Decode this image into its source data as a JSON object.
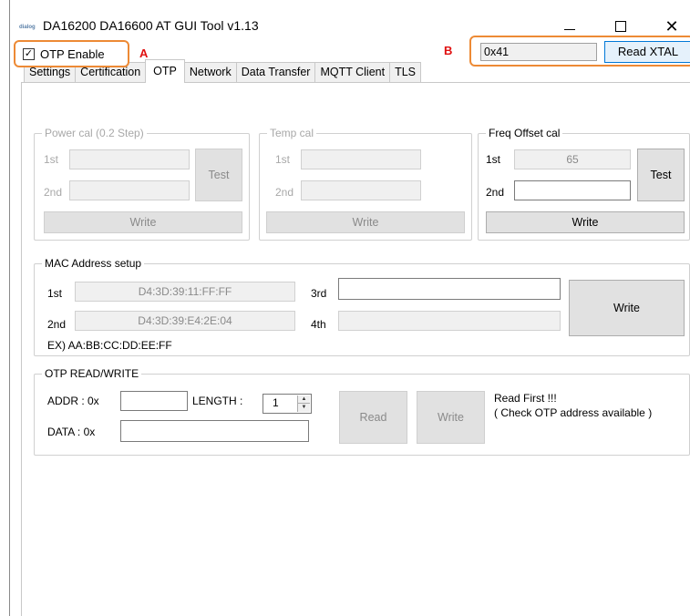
{
  "window": {
    "title": "DA16200 DA16600 AT GUI Tool v1.13",
    "app_icon_text": "dialog"
  },
  "tabs": [
    {
      "label": "Settings"
    },
    {
      "label": "Certification"
    },
    {
      "label": "OTP"
    },
    {
      "label": "Network"
    },
    {
      "label": "Data Transfer"
    },
    {
      "label": "MQTT Client"
    },
    {
      "label": "TLS"
    }
  ],
  "otp": {
    "enable_label": "OTP Enable",
    "enable_checked": true,
    "marker_a": "A",
    "marker_b": "B",
    "xtal_value": "0x41",
    "read_xtal_label": "Read XTAL"
  },
  "power_cal": {
    "title": "Power cal (0.2 Step)",
    "first_label": "1st",
    "second_label": "2nd",
    "test_label": "Test",
    "write_label": "Write"
  },
  "temp_cal": {
    "title": "Temp cal",
    "first_label": "1st",
    "second_label": "2nd",
    "write_label": "Write"
  },
  "freq_offset_cal": {
    "title": "Freq Offset cal",
    "first_label": "1st",
    "first_value": "65",
    "second_label": "2nd",
    "second_value": "",
    "test_label": "Test",
    "write_label": "Write"
  },
  "mac_setup": {
    "title": "MAC Address setup",
    "first_label": "1st",
    "first_value": "D4:3D:39:11:FF:FF",
    "second_label": "2nd",
    "second_value": "D4:3D:39:E4:2E:04",
    "third_label": "3rd",
    "third_value": "",
    "fourth_label": "4th",
    "fourth_value": "",
    "example": "EX) AA:BB:CC:DD:EE:FF",
    "write_label": "Write"
  },
  "otp_rw": {
    "title": "OTP READ/WRITE",
    "addr_label": "ADDR : 0x",
    "addr_value": "",
    "length_label": "LENGTH :",
    "length_value": "1",
    "data_label": "DATA : 0x",
    "data_value": "",
    "read_label": "Read",
    "write_label": "Write",
    "note_line1": "Read First !!!",
    "note_line2": "( Check OTP address available )"
  }
}
